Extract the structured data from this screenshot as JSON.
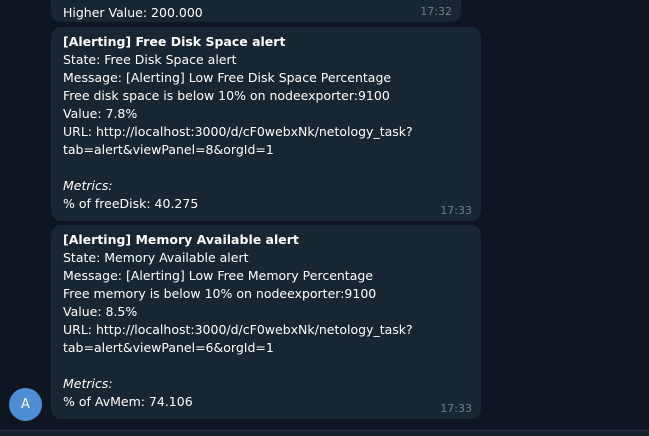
{
  "messages": [
    {
      "lines": [
        "Higher Value: 200.000"
      ],
      "time": "17:32"
    },
    {
      "title": "[Alerting] Free Disk Space alert",
      "lines": [
        "State: Free Disk Space alert",
        "Message: [Alerting] Low Free Disk Space Percentage",
        "Free disk space is below 10% on nodeexporter:9100",
        "Value: 7.8%",
        "URL: http://localhost:3000/d/cF0webxNk/netology_task?",
        "tab=alert&viewPanel=8&orgId=1"
      ],
      "metrics_label": "Metrics:",
      "metric": "% of freeDisk: 40.275",
      "time": "17:33"
    },
    {
      "title": "[Alerting] Memory Available alert",
      "lines": [
        "State: Memory Available alert",
        "Message: [Alerting] Low Free Memory Percentage",
        "Free memory is below 10% on nodeexporter:9100",
        "Value: 8.5%",
        "URL: http://localhost:3000/d/cF0webxNk/netology_task?",
        "tab=alert&viewPanel=6&orgId=1"
      ],
      "metrics_label": "Metrics:",
      "metric": "% of AvMem: 74.106",
      "time": "17:33"
    }
  ],
  "sender": {
    "avatar_letter": "A",
    "avatar_color": "#4d8ed4"
  },
  "colors": {
    "background": "#0e1621",
    "bubble": "#182533",
    "time": "#6d7f8f"
  }
}
